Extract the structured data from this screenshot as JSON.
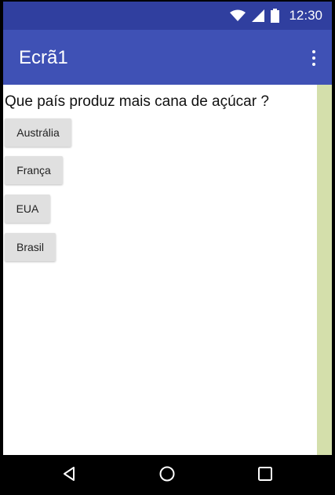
{
  "status_bar": {
    "time": "12:30",
    "icons": [
      "wifi-icon",
      "cell-signal-icon",
      "battery-icon"
    ]
  },
  "app_bar": {
    "title": "Ecrã1",
    "menu_icon": "overflow-menu-icon"
  },
  "main": {
    "question": "Que país produz mais cana de açúcar ?",
    "answers": [
      "Austrália",
      "França",
      "EUA",
      "Brasil"
    ]
  },
  "nav_bar": {
    "icons": [
      "back-icon",
      "home-icon",
      "recents-icon"
    ]
  },
  "colors": {
    "status_bar": "#303f9f",
    "app_bar": "#3f51b5",
    "side_strip": "#d4dfab",
    "button": "#e0e0e0"
  }
}
